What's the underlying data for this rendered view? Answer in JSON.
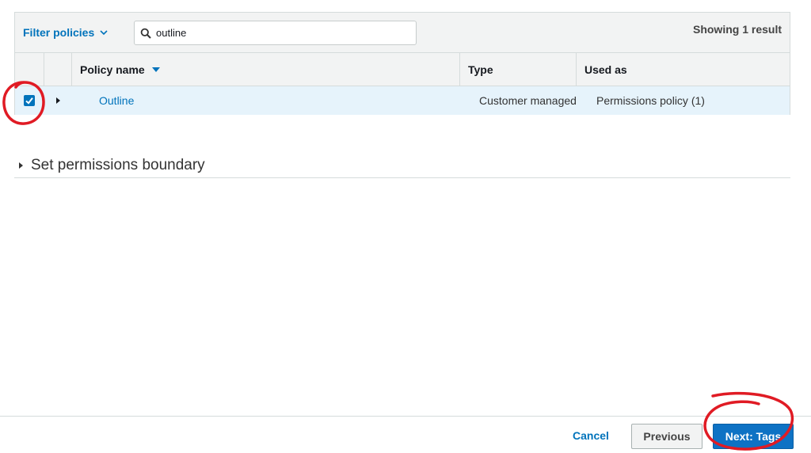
{
  "toolbar": {
    "filter_label": "Filter policies",
    "search_value": "outline",
    "search_placeholder": "Search",
    "result_count": "Showing 1 result"
  },
  "table": {
    "columns": [
      "Policy name",
      "Type",
      "Used as"
    ],
    "rows": [
      {
        "selected": true,
        "policy_name": "Outline",
        "type": "Customer managed",
        "used_as": "Permissions policy (1)"
      }
    ]
  },
  "boundary": {
    "label": "Set permissions boundary"
  },
  "footer": {
    "cancel_label": "Cancel",
    "previous_label": "Previous",
    "next_label": "Next: Tags"
  },
  "colors": {
    "link": "#0073bb",
    "primary_button": "#0e72c4",
    "row_highlight": "#e6f3fb",
    "annotation": "#e01b24"
  },
  "icons": {
    "filter_chevron": "chevron-down-icon",
    "search": "search-icon",
    "sort": "sort-descending-icon",
    "checkbox": "checkbox-checked-icon",
    "row_expand": "caret-right-icon",
    "boundary_expand": "caret-right-icon"
  }
}
